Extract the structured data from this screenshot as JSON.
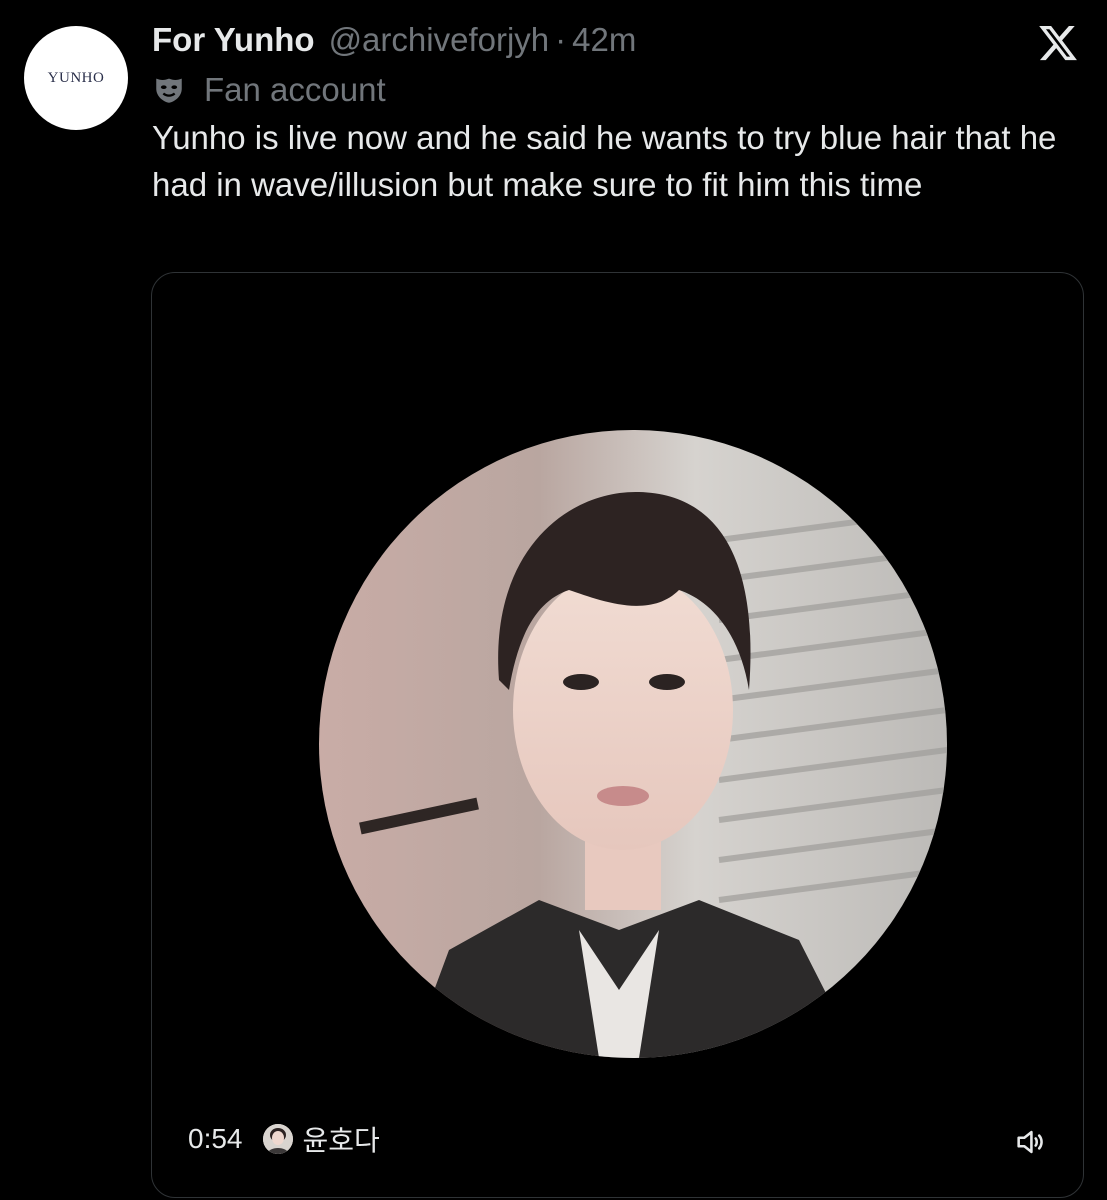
{
  "post": {
    "avatar_text": "YUNHO",
    "display_name": "For Yunho",
    "handle": "@archiveforjyh",
    "separator": "·",
    "time": "42m",
    "label": "Fan account",
    "text": "Yunho is live now and he said he wants to try blue hair that he had in wave/illusion but make sure to fit him this time"
  },
  "media": {
    "duration": "0:54",
    "uploader": "윤호다"
  },
  "icons": {
    "platform": "x-logo-icon",
    "label": "mask-icon",
    "volume": "volume-icon"
  },
  "colors": {
    "background": "#000000",
    "text_primary": "#e7e9ea",
    "text_secondary": "#71767b",
    "border": "#2f3336"
  }
}
